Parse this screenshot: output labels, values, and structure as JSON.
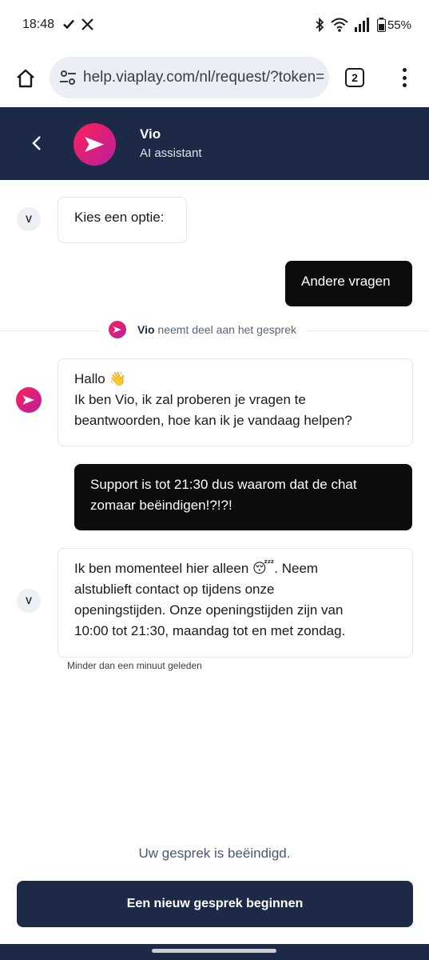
{
  "status_bar": {
    "time": "18:48",
    "battery": "55%",
    "icons": [
      "check-icon",
      "x-logo-icon",
      "bluetooth-icon",
      "wifi-icon",
      "signal-icon",
      "battery-icon"
    ]
  },
  "browser": {
    "url": "help.viaplay.com/nl/request/?token=",
    "tab_count": "2"
  },
  "chat_header": {
    "name": "Vio",
    "subtitle": "AI assistant"
  },
  "messages": {
    "bot_option_prompt": {
      "avatar": "V",
      "text": "Kies een optie:"
    },
    "user_option": {
      "text": "Andere vragen"
    },
    "join_notice": {
      "name": "Vio",
      "text": "neemt deel aan het gesprek"
    },
    "bot_greeting": {
      "line1": "Hallo 👋",
      "line2": "Ik ben Vio, ik zal proberen je vragen te",
      "line3": "beantwoorden, hoe kan ik je vandaag helpen?"
    },
    "user_complaint": {
      "line1": "Support is tot 21:30 dus waarom dat de chat",
      "line2": "zomaar beëindigen!?!?!"
    },
    "bot_reply": {
      "avatar": "V",
      "line1": "Ik ben momenteel hier alleen 😴. Neem",
      "line2": "alstublieft contact op tijdens onze",
      "line3": "openingstijden. Onze openingstijden zijn van",
      "line4": "10:00 tot 21:30, maandag tot en met zondag."
    },
    "timestamp": "Minder dan een minuut geleden"
  },
  "footer": {
    "ended_text": "Uw gesprek is beëindigd.",
    "new_chat_label": "Een nieuw gesprek beginnen"
  },
  "colors": {
    "header_bg": "#1c2a48",
    "user_bubble": "#0c0c0c",
    "brand_gradient_start": "#ff1f5a",
    "brand_gradient_end": "#b81fa0"
  }
}
